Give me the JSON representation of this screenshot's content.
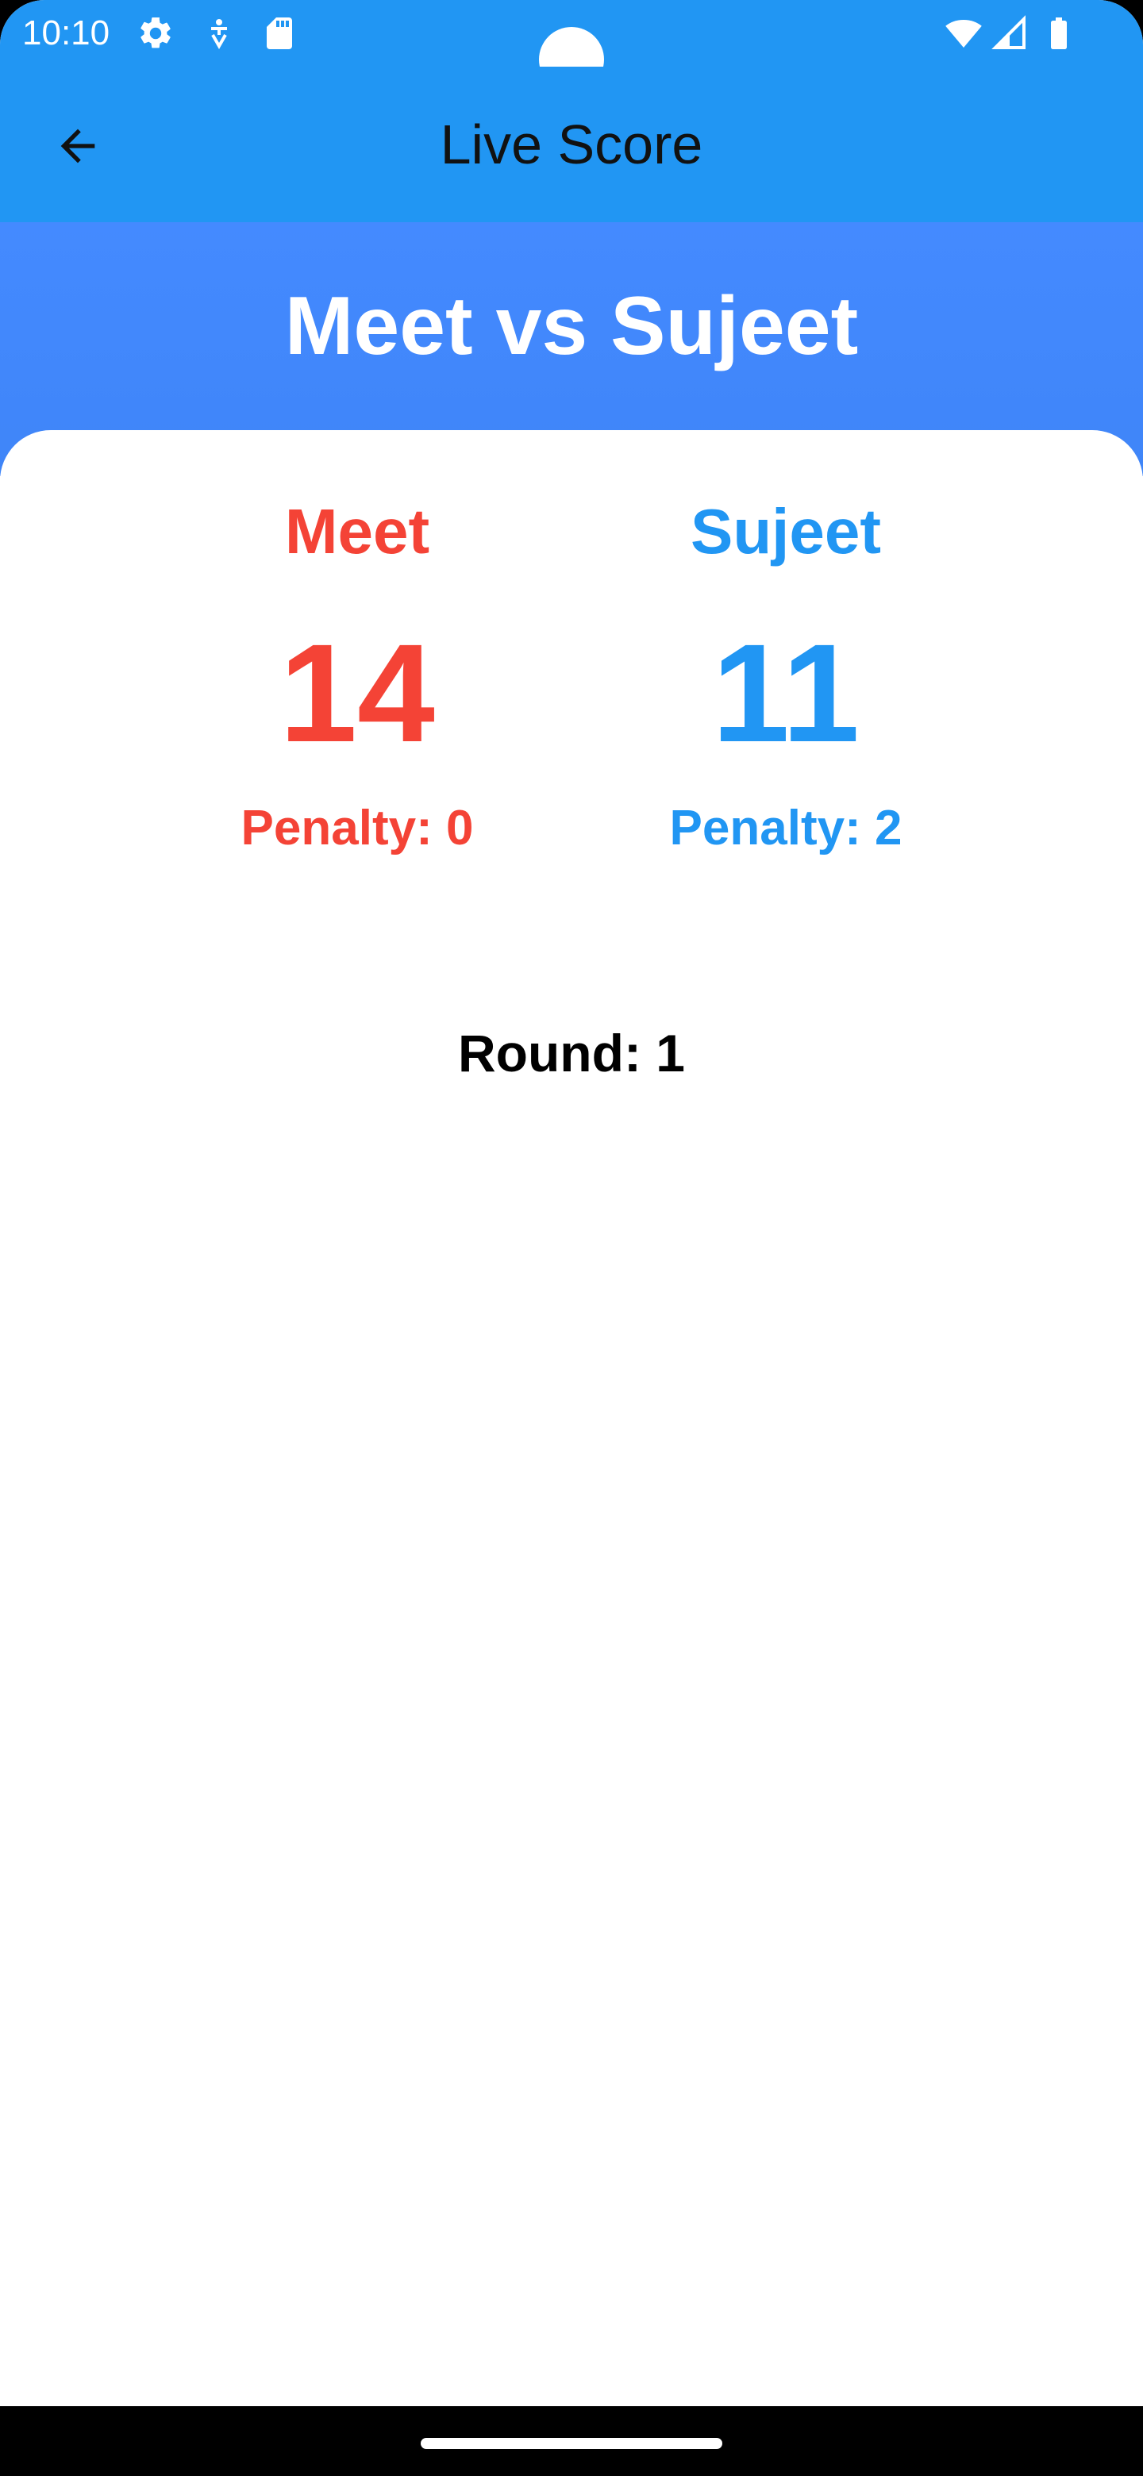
{
  "status_bar": {
    "time": "10:10",
    "icons": [
      "gear-icon",
      "accessibility-icon",
      "sd-card-icon",
      "wifi-icon",
      "signal-icon",
      "battery-icon"
    ],
    "color": "#2196F3"
  },
  "app_bar": {
    "title": "Live Score",
    "back_icon": "arrow-left-icon"
  },
  "match": {
    "title": "Meet vs Sujeet",
    "header_color": "#448AFF"
  },
  "players": [
    {
      "name": "Meet",
      "score": "14",
      "penalty": "Penalty: 0",
      "color": "#F44336"
    },
    {
      "name": "Sujeet",
      "score": "11",
      "penalty": "Penalty: 2",
      "color": "#2196F3"
    }
  ],
  "round": "Round: 1"
}
